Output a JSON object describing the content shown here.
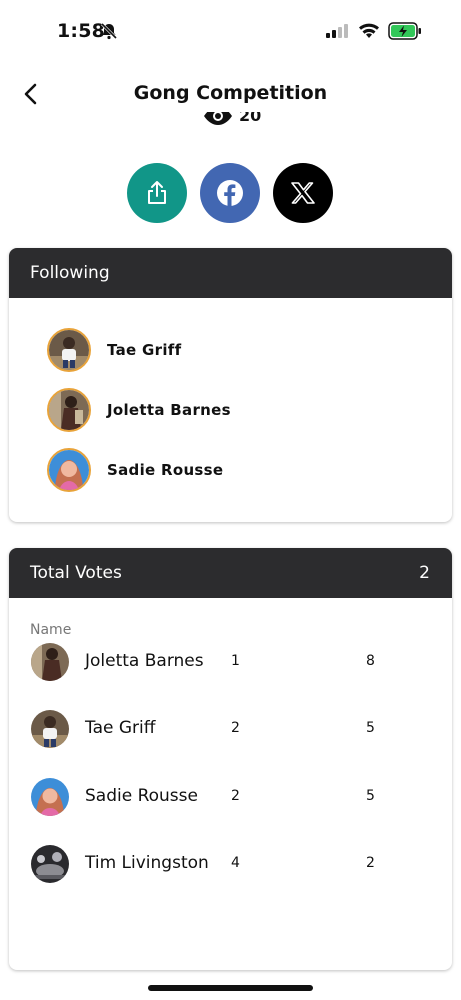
{
  "status_bar": {
    "time": "1:58"
  },
  "header": {
    "title": "Gong Competition",
    "views_count": "20"
  },
  "share": {
    "buttons": [
      "share",
      "facebook",
      "x"
    ]
  },
  "following": {
    "title": "Following",
    "people": [
      {
        "name": "Tae Griff"
      },
      {
        "name": "Joletta Barnes"
      },
      {
        "name": "Sadie Rousse"
      }
    ]
  },
  "votes": {
    "title": "Total Votes",
    "total": "2",
    "column_name": "Name",
    "rows": [
      {
        "name": "Joletta Barnes",
        "rank": "1",
        "votes": "8"
      },
      {
        "name": "Tae Griff",
        "rank": "2",
        "votes": "5"
      },
      {
        "name": "Sadie Rousse",
        "rank": "2",
        "votes": "5"
      },
      {
        "name": "Tim Livingston",
        "rank": "4",
        "votes": "2"
      }
    ]
  },
  "colors": {
    "teal": "#119688",
    "facebook": "#4267b2",
    "header_dark": "#2c2c2e",
    "avatar_ring": "#e8a33a"
  }
}
